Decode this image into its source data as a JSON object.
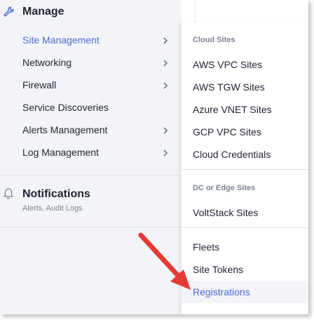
{
  "sidebar": {
    "section_title": "Manage",
    "items": [
      {
        "label": "Site Management",
        "active": true,
        "has_submenu": true
      },
      {
        "label": "Networking",
        "has_submenu": true
      },
      {
        "label": "Firewall",
        "has_submenu": true
      },
      {
        "label": "Service Discoveries",
        "has_submenu": false
      },
      {
        "label": "Alerts Management",
        "has_submenu": true
      },
      {
        "label": "Log Management",
        "has_submenu": true
      }
    ],
    "notifications": {
      "title": "Notifications",
      "subtitle": "Alerts, Audit Logs"
    }
  },
  "flyout": {
    "groups": [
      {
        "header": "Cloud Sites",
        "items": [
          "AWS VPC Sites",
          "AWS TGW Sites",
          "Azure VNET Sites",
          "GCP VPC Sites",
          "Cloud Credentials"
        ]
      },
      {
        "header": "DC or Edge Sites",
        "items": [
          "VoltStack Sites"
        ]
      },
      {
        "header": "",
        "items": [
          "Fleets",
          "Site Tokens",
          "Registrations"
        ]
      }
    ],
    "highlighted_item": "Registrations"
  },
  "colors": {
    "accent": "#4d6bd8",
    "sidebar_bg": "#f3f4f7",
    "annotation_arrow": "#e53935"
  },
  "icons": {
    "manage": "wrench-icon",
    "notifications": "bell-icon",
    "submenu": "chevron-right-icon"
  }
}
